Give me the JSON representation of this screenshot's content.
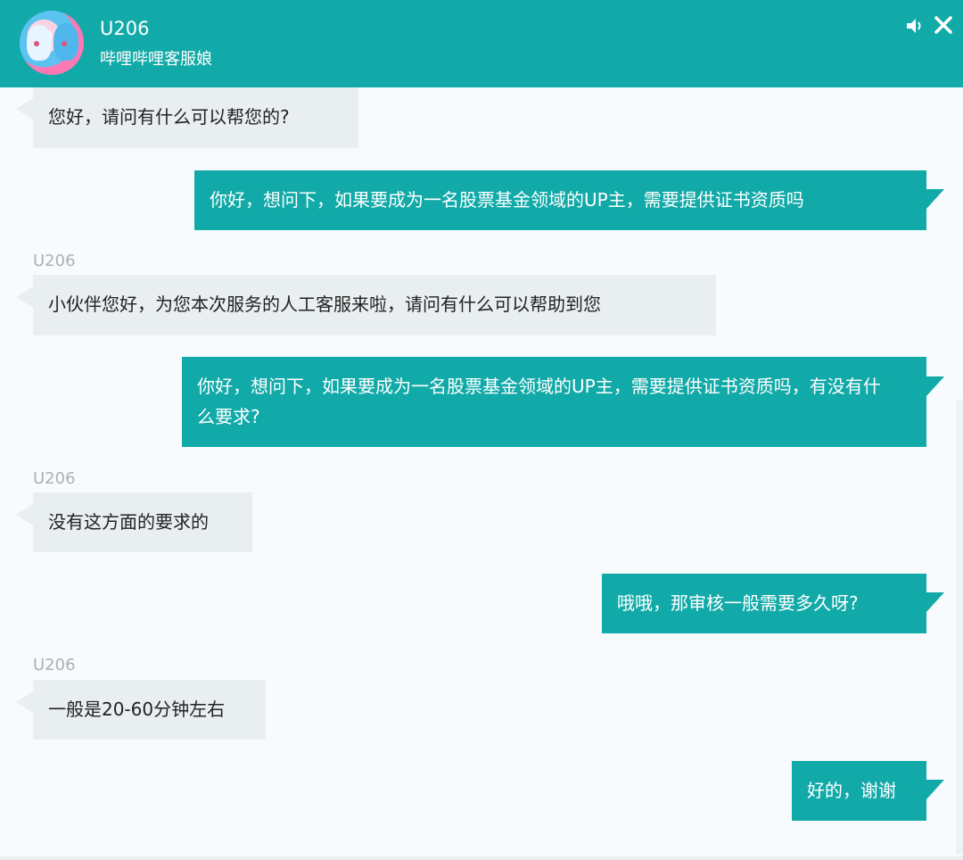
{
  "header": {
    "title": "U206",
    "subtitle": "哔哩哔哩客服娘",
    "accent_color": "#12aaa8",
    "speaker_icon": "speaker-icon",
    "close_icon": "close-icon"
  },
  "messages": [
    {
      "side": "left",
      "sender": "",
      "text": "您好，请问有什么可以帮您的?"
    },
    {
      "side": "right",
      "text": "你好，想问下，如果要成为一名股票基金领域的UP主，需要提供证书资质吗"
    },
    {
      "side": "left",
      "sender": "U206",
      "text": "小伙伴您好，为您本次服务的人工客服来啦，请问有什么可以帮助到您"
    },
    {
      "side": "right",
      "text": "你好，想问下，如果要成为一名股票基金领域的UP主，需要提供证书资质吗，有没有什么要求?"
    },
    {
      "side": "left",
      "sender": "U206",
      "text": "没有这方面的要求的"
    },
    {
      "side": "right",
      "text": "哦哦，那审核一般需要多久呀?"
    },
    {
      "side": "left",
      "sender": "U206",
      "text": "一般是20-60分钟左右"
    },
    {
      "side": "right",
      "text": "好的，谢谢"
    }
  ]
}
